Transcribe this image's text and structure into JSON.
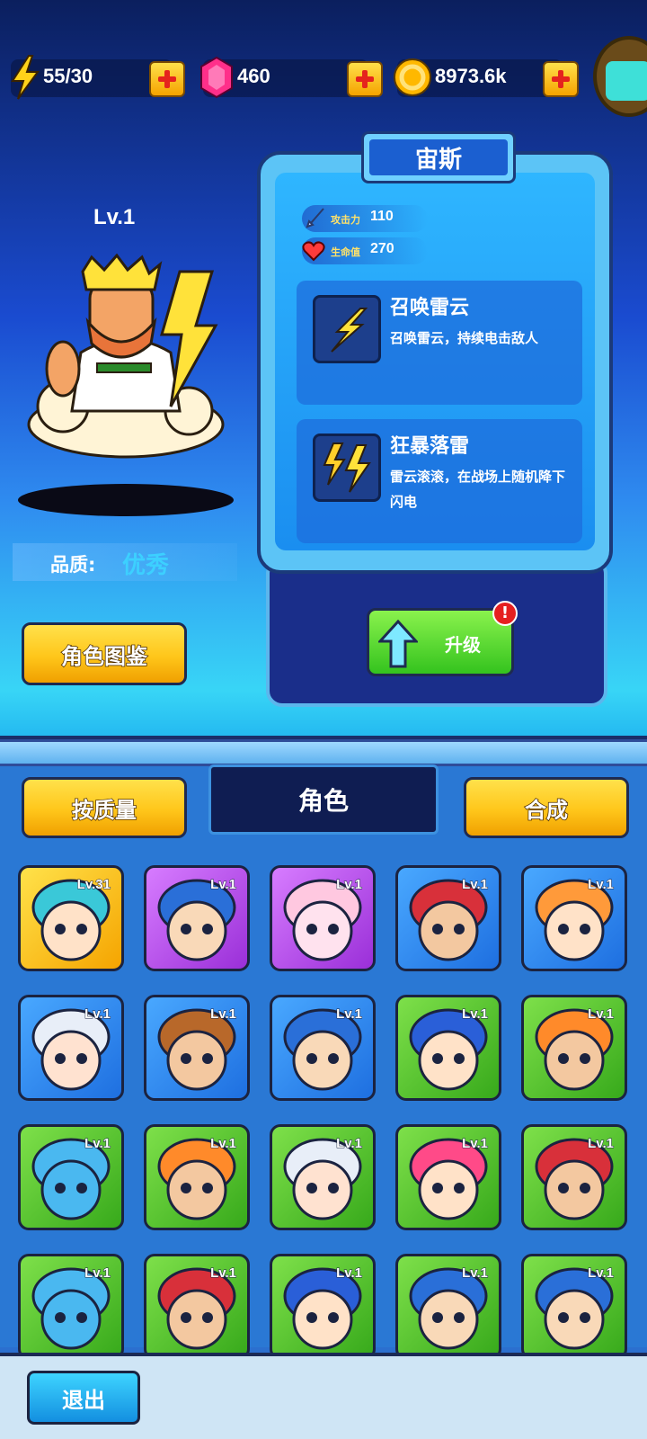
{
  "topbar": {
    "energy": "55/30",
    "gems": "460",
    "gold": "8973.6k"
  },
  "hero": {
    "level": "Lv.1",
    "name": "宙斯",
    "quality_label": "品质:",
    "quality_value": "优秀",
    "stats": {
      "attack_label": "攻击力",
      "attack_value": "110",
      "hp_label": "生命值",
      "hp_value": "270"
    },
    "skills": [
      {
        "name": "召唤雷云",
        "desc": "召唤雷云，持续电击敌人"
      },
      {
        "name": "狂暴落雷",
        "desc": "雷云滚滚，在战场上随机降下闪电"
      }
    ]
  },
  "buttons": {
    "codex": "角色图鉴",
    "upgrade": "升级",
    "sort_quality": "按质量",
    "merge": "合成",
    "exit": "退出"
  },
  "roster_title": "角色",
  "badge": "!",
  "roster": [
    {
      "lv": "Lv.31",
      "color": "gold",
      "face": "elf-girl"
    },
    {
      "lv": "Lv.1",
      "color": "purple",
      "face": "glasses-man"
    },
    {
      "lv": "Lv.1",
      "color": "purple",
      "face": "pink-girl"
    },
    {
      "lv": "Lv.1",
      "color": "blue",
      "face": "bearded-man"
    },
    {
      "lv": "Lv.1",
      "color": "blue",
      "face": "bun-girl"
    },
    {
      "lv": "Lv.1",
      "color": "blue",
      "face": "silver-hair"
    },
    {
      "lv": "Lv.1",
      "color": "blue",
      "face": "cowboy"
    },
    {
      "lv": "Lv.1",
      "color": "blue",
      "face": "glasses-man"
    },
    {
      "lv": "Lv.1",
      "color": "green",
      "face": "hood-girl"
    },
    {
      "lv": "Lv.1",
      "color": "green",
      "face": "mustache-man"
    },
    {
      "lv": "Lv.1",
      "color": "green",
      "face": "monster"
    },
    {
      "lv": "Lv.1",
      "color": "green",
      "face": "mustache-man"
    },
    {
      "lv": "Lv.1",
      "color": "green",
      "face": "silver-hair"
    },
    {
      "lv": "Lv.1",
      "color": "green",
      "face": "goggles-girl"
    },
    {
      "lv": "Lv.1",
      "color": "green",
      "face": "bearded-man"
    },
    {
      "lv": "Lv.1",
      "color": "green",
      "face": "monster"
    },
    {
      "lv": "Lv.1",
      "color": "green",
      "face": "bearded-man"
    },
    {
      "lv": "Lv.1",
      "color": "green",
      "face": "hood-girl"
    },
    {
      "lv": "Lv.1",
      "color": "green",
      "face": "glasses-man"
    },
    {
      "lv": "Lv.1",
      "color": "green",
      "face": "glasses-man"
    }
  ]
}
